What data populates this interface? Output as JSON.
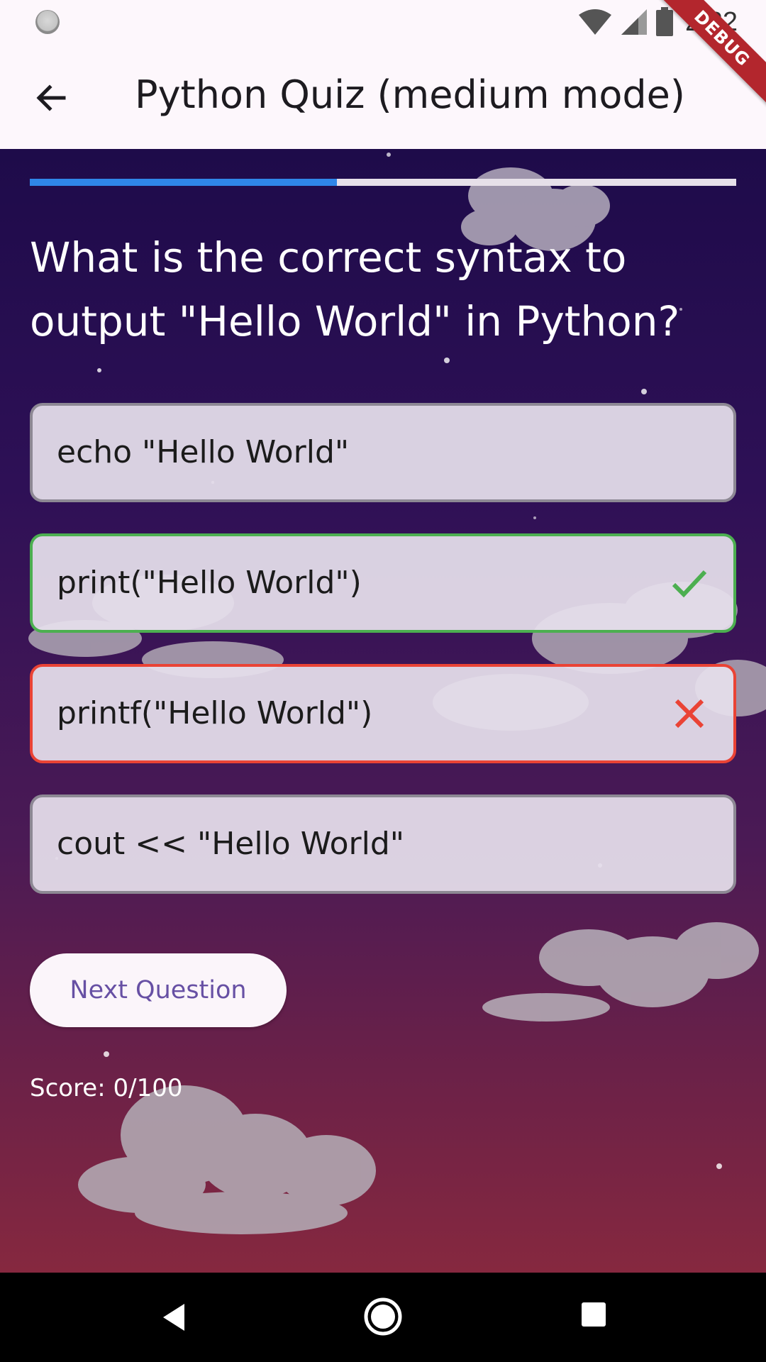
{
  "status_bar": {
    "time": "2:22",
    "icons": [
      "loading-circle-icon",
      "wifi-icon",
      "signal-icon",
      "battery-icon"
    ]
  },
  "app_bar": {
    "title": "Python Quiz (medium mode)",
    "back_icon": "arrow-back-icon",
    "debug_banner": "DEBUG"
  },
  "quiz": {
    "progress": 0.435,
    "question": "What is the correct syntax to output \"Hello World\" in Python?",
    "options": [
      {
        "label": "echo \"Hello World\"",
        "state": "neutral"
      },
      {
        "label": "print(\"Hello World\")",
        "state": "correct",
        "icon": "check-icon"
      },
      {
        "label": "printf(\"Hello World\")",
        "state": "wrong",
        "icon": "close-icon"
      },
      {
        "label": "cout << \"Hello World\"",
        "state": "neutral"
      }
    ],
    "next_button_label": "Next Question",
    "score": "Score: 0/100"
  },
  "colors": {
    "progress_fill": "#2f86e8",
    "correct": "#4caf50",
    "wrong": "#ea4335",
    "button_text": "#6750a4"
  },
  "nav_bar": {
    "icons": [
      "nav-back-icon",
      "nav-home-icon",
      "nav-recents-icon"
    ]
  }
}
